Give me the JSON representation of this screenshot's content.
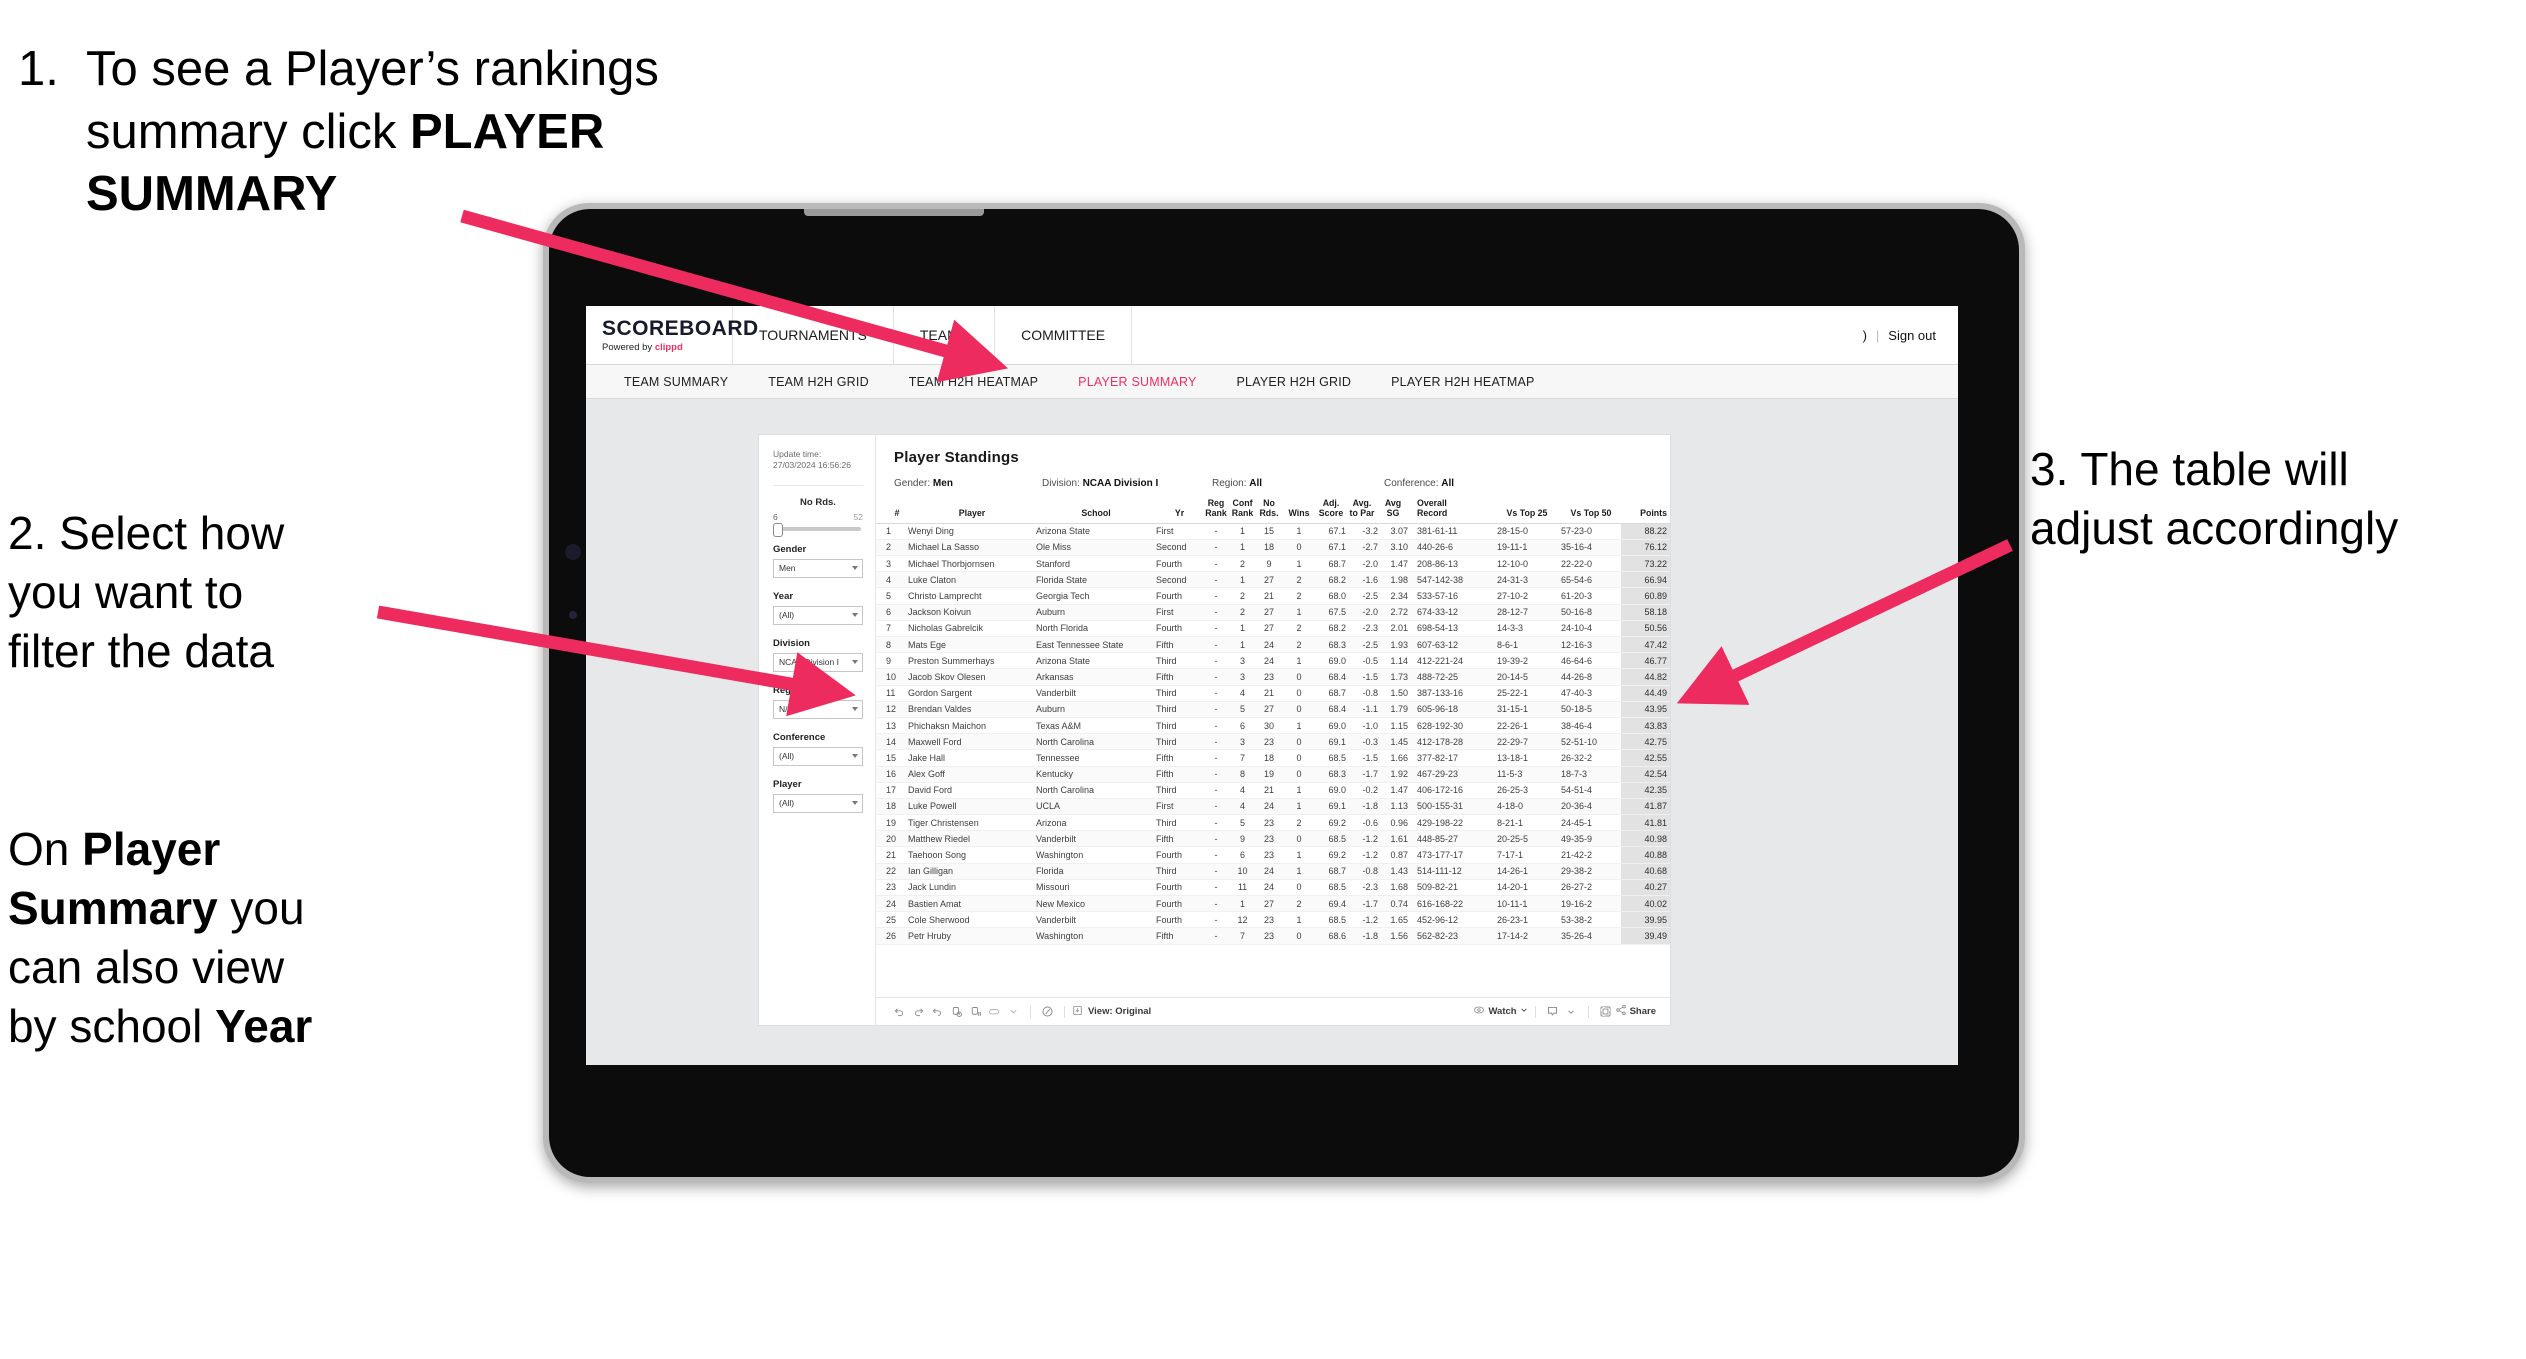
{
  "annotations": {
    "a1_num": "1.",
    "a1_l1": "To see a Player’s rankings",
    "a1_l2_plain": "summary click ",
    "a1_l2_bold": "PLAYER",
    "a1_l3_bold": "SUMMARY",
    "a2_l1": "2. Select how",
    "a2_l2": "you want to",
    "a2_l3": "filter the data",
    "a2b_p1": "On ",
    "a2b_b1": "Player",
    "a2b_b2": "Summary",
    "a2b_p2": " you",
    "a2b_p3": "can also view",
    "a2b_p4": "by school ",
    "a2b_b3": "Year",
    "a3_l1": "3. The table will",
    "a3_l2": "adjust accordingly",
    "arrow_color": "#ED2B5E"
  },
  "app": {
    "brand": {
      "title": "SCOREBOARD",
      "powered_prefix": "Powered by ",
      "powered_brand": "clippd"
    },
    "topnav": [
      "TOURNAMENTS",
      "TEAMS",
      "COMMITTEE"
    ],
    "account": {
      "user_glyph": ")",
      "separator": "|",
      "sign_out": "Sign out"
    },
    "subnav": {
      "items": [
        {
          "label": "TEAM SUMMARY",
          "active": false
        },
        {
          "label": "TEAM H2H GRID",
          "active": false
        },
        {
          "label": "TEAM H2H HEATMAP",
          "active": false
        },
        {
          "label": "PLAYER SUMMARY",
          "active": true
        },
        {
          "label": "PLAYER H2H GRID",
          "active": false
        },
        {
          "label": "PLAYER H2H HEATMAP",
          "active": false
        }
      ]
    }
  },
  "filters": {
    "update_label": "Update time:",
    "update_value": "27/03/2024 16:56:26",
    "slider": {
      "title": "No Rds.",
      "min": "6",
      "max": "52"
    },
    "fields": [
      {
        "label": "Gender",
        "value": "Men"
      },
      {
        "label": "Year",
        "value": "(All)"
      },
      {
        "label": "Division",
        "value": "NCAA Division I"
      },
      {
        "label": "Region",
        "value": "N/A"
      },
      {
        "label": "Conference",
        "value": "(All)"
      },
      {
        "label": "Player",
        "value": "(All)"
      }
    ]
  },
  "standings": {
    "title": "Player Standings",
    "filter_line": [
      {
        "label": "Gender: ",
        "value": "Men"
      },
      {
        "label": "Division: ",
        "value": "NCAA Division I"
      },
      {
        "label": "Region: ",
        "value": "All"
      },
      {
        "label": "Conference: ",
        "value": "All"
      }
    ],
    "columns": [
      {
        "key": "rank",
        "label": "#"
      },
      {
        "key": "player",
        "label": "Player"
      },
      {
        "key": "school",
        "label": "School"
      },
      {
        "key": "yr",
        "label": "Yr"
      },
      {
        "key": "reg_rank",
        "label": "Reg\nRank"
      },
      {
        "key": "conf_rank",
        "label": "Conf\nRank"
      },
      {
        "key": "no_rds",
        "label": "No\nRds."
      },
      {
        "key": "wins",
        "label": "Wins"
      },
      {
        "key": "adj_score",
        "label": "Adj.\nScore"
      },
      {
        "key": "avg_to_par",
        "label": "Avg.\nto Par"
      },
      {
        "key": "avg_sg",
        "label": "Avg\nSG"
      },
      {
        "key": "overall_record",
        "label": "Overall\nRecord"
      },
      {
        "key": "vs_top_25",
        "label": "Vs Top 25"
      },
      {
        "key": "vs_top_50",
        "label": "Vs Top 50"
      },
      {
        "key": "points",
        "label": "Points"
      }
    ],
    "rows": [
      [
        "1",
        "Wenyi Ding",
        "Arizona State",
        "First",
        "-",
        "1",
        "15",
        "1",
        "67.1",
        "-3.2",
        "3.07",
        "381-61-11",
        "28-15-0",
        "57-23-0",
        "88.22"
      ],
      [
        "2",
        "Michael La Sasso",
        "Ole Miss",
        "Second",
        "-",
        "1",
        "18",
        "0",
        "67.1",
        "-2.7",
        "3.10",
        "440-26-6",
        "19-11-1",
        "35-16-4",
        "76.12"
      ],
      [
        "3",
        "Michael Thorbjornsen",
        "Stanford",
        "Fourth",
        "-",
        "2",
        "9",
        "1",
        "68.7",
        "-2.0",
        "1.47",
        "208-86-13",
        "12-10-0",
        "22-22-0",
        "73.22"
      ],
      [
        "4",
        "Luke Claton",
        "Florida State",
        "Second",
        "-",
        "1",
        "27",
        "2",
        "68.2",
        "-1.6",
        "1.98",
        "547-142-38",
        "24-31-3",
        "65-54-6",
        "66.94"
      ],
      [
        "5",
        "Christo Lamprecht",
        "Georgia Tech",
        "Fourth",
        "-",
        "2",
        "21",
        "2",
        "68.0",
        "-2.5",
        "2.34",
        "533-57-16",
        "27-10-2",
        "61-20-3",
        "60.89"
      ],
      [
        "6",
        "Jackson Koivun",
        "Auburn",
        "First",
        "-",
        "2",
        "27",
        "1",
        "67.5",
        "-2.0",
        "2.72",
        "674-33-12",
        "28-12-7",
        "50-16-8",
        "58.18"
      ],
      [
        "7",
        "Nicholas Gabrelcik",
        "North Florida",
        "Fourth",
        "-",
        "1",
        "27",
        "2",
        "68.2",
        "-2.3",
        "2.01",
        "698-54-13",
        "14-3-3",
        "24-10-4",
        "50.56"
      ],
      [
        "8",
        "Mats Ege",
        "East Tennessee State",
        "Fifth",
        "-",
        "1",
        "24",
        "2",
        "68.3",
        "-2.5",
        "1.93",
        "607-63-12",
        "8-6-1",
        "12-16-3",
        "47.42"
      ],
      [
        "9",
        "Preston Summerhays",
        "Arizona State",
        "Third",
        "-",
        "3",
        "24",
        "1",
        "69.0",
        "-0.5",
        "1.14",
        "412-221-24",
        "19-39-2",
        "46-64-6",
        "46.77"
      ],
      [
        "10",
        "Jacob Skov Olesen",
        "Arkansas",
        "Fifth",
        "-",
        "3",
        "23",
        "0",
        "68.4",
        "-1.5",
        "1.73",
        "488-72-25",
        "20-14-5",
        "44-26-8",
        "44.82"
      ],
      [
        "11",
        "Gordon Sargent",
        "Vanderbilt",
        "Third",
        "-",
        "4",
        "21",
        "0",
        "68.7",
        "-0.8",
        "1.50",
        "387-133-16",
        "25-22-1",
        "47-40-3",
        "44.49"
      ],
      [
        "12",
        "Brendan Valdes",
        "Auburn",
        "Third",
        "-",
        "5",
        "27",
        "0",
        "68.4",
        "-1.1",
        "1.79",
        "605-96-18",
        "31-15-1",
        "50-18-5",
        "43.95"
      ],
      [
        "13",
        "Phichaksn Maichon",
        "Texas A&M",
        "Third",
        "-",
        "6",
        "30",
        "1",
        "69.0",
        "-1.0",
        "1.15",
        "628-192-30",
        "22-26-1",
        "38-46-4",
        "43.83"
      ],
      [
        "14",
        "Maxwell Ford",
        "North Carolina",
        "Third",
        "-",
        "3",
        "23",
        "0",
        "69.1",
        "-0.3",
        "1.45",
        "412-178-28",
        "22-29-7",
        "52-51-10",
        "42.75"
      ],
      [
        "15",
        "Jake Hall",
        "Tennessee",
        "Fifth",
        "-",
        "7",
        "18",
        "0",
        "68.5",
        "-1.5",
        "1.66",
        "377-82-17",
        "13-18-1",
        "26-32-2",
        "42.55"
      ],
      [
        "16",
        "Alex Goff",
        "Kentucky",
        "Fifth",
        "-",
        "8",
        "19",
        "0",
        "68.3",
        "-1.7",
        "1.92",
        "467-29-23",
        "11-5-3",
        "18-7-3",
        "42.54"
      ],
      [
        "17",
        "David Ford",
        "North Carolina",
        "Third",
        "-",
        "4",
        "21",
        "1",
        "69.0",
        "-0.2",
        "1.47",
        "406-172-16",
        "26-25-3",
        "54-51-4",
        "42.35"
      ],
      [
        "18",
        "Luke Powell",
        "UCLA",
        "First",
        "-",
        "4",
        "24",
        "1",
        "69.1",
        "-1.8",
        "1.13",
        "500-155-31",
        "4-18-0",
        "20-36-4",
        "41.87"
      ],
      [
        "19",
        "Tiger Christensen",
        "Arizona",
        "Third",
        "-",
        "5",
        "23",
        "2",
        "69.2",
        "-0.6",
        "0.96",
        "429-198-22",
        "8-21-1",
        "24-45-1",
        "41.81"
      ],
      [
        "20",
        "Matthew Riedel",
        "Vanderbilt",
        "Fifth",
        "-",
        "9",
        "23",
        "0",
        "68.5",
        "-1.2",
        "1.61",
        "448-85-27",
        "20-25-5",
        "49-35-9",
        "40.98"
      ],
      [
        "21",
        "Taehoon Song",
        "Washington",
        "Fourth",
        "-",
        "6",
        "23",
        "1",
        "69.2",
        "-1.2",
        "0.87",
        "473-177-17",
        "7-17-1",
        "21-42-2",
        "40.88"
      ],
      [
        "22",
        "Ian Gilligan",
        "Florida",
        "Third",
        "-",
        "10",
        "24",
        "1",
        "68.7",
        "-0.8",
        "1.43",
        "514-111-12",
        "14-26-1",
        "29-38-2",
        "40.68"
      ],
      [
        "23",
        "Jack Lundin",
        "Missouri",
        "Fourth",
        "-",
        "11",
        "24",
        "0",
        "68.5",
        "-2.3",
        "1.68",
        "509-82-21",
        "14-20-1",
        "26-27-2",
        "40.27"
      ],
      [
        "24",
        "Bastien Amat",
        "New Mexico",
        "Fourth",
        "-",
        "1",
        "27",
        "2",
        "69.4",
        "-1.7",
        "0.74",
        "616-168-22",
        "10-11-1",
        "19-16-2",
        "40.02"
      ],
      [
        "25",
        "Cole Sherwood",
        "Vanderbilt",
        "Fourth",
        "-",
        "12",
        "23",
        "1",
        "68.5",
        "-1.2",
        "1.65",
        "452-96-12",
        "26-23-1",
        "53-38-2",
        "39.95"
      ],
      [
        "26",
        "Petr Hruby",
        "Washington",
        "Fifth",
        "-",
        "7",
        "23",
        "0",
        "68.6",
        "-1.8",
        "1.56",
        "562-82-23",
        "17-14-2",
        "35-26-4",
        "39.49"
      ]
    ]
  },
  "toolbar": {
    "view_label": "View: Original",
    "watch_label": "Watch",
    "share_label": "Share"
  }
}
